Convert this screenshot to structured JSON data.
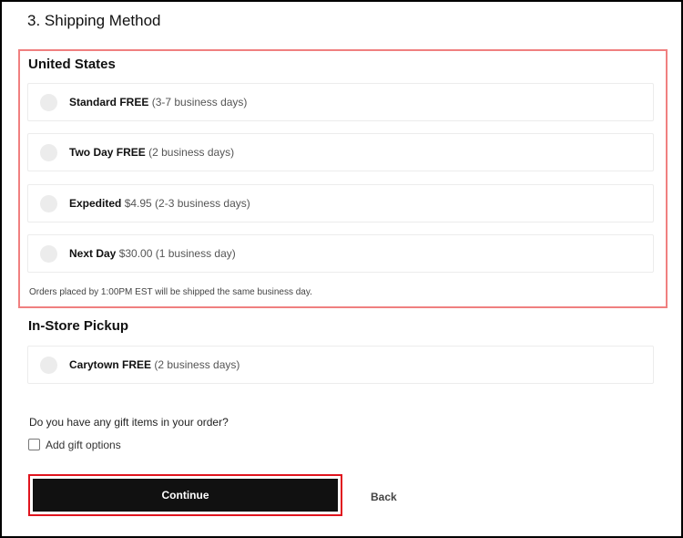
{
  "step_title": "3. Shipping Method",
  "regions": {
    "us": {
      "title": "United States",
      "options": [
        {
          "name": "Standard FREE",
          "detail": " (3-7 business days)"
        },
        {
          "name": "Two Day FREE",
          "detail": " (2 business days)"
        },
        {
          "name": "Expedited",
          "detail": " $4.95 (2-3 business days)"
        },
        {
          "name": "Next Day",
          "detail": " $30.00 (1 business day)"
        }
      ],
      "note": "Orders placed by 1:00PM EST will be shipped the same business day."
    },
    "pickup": {
      "title": "In-Store Pickup",
      "options": [
        {
          "name": "Carytown FREE",
          "detail": " (2 business days)"
        }
      ]
    }
  },
  "gift": {
    "question": "Do you have any gift items in your order?",
    "checkbox_label": "Add gift options",
    "checked": false
  },
  "actions": {
    "continue_label": "Continue",
    "back_label": "Back"
  },
  "colors": {
    "highlight_border": "#f08080",
    "continue_highlight": "#e0141e",
    "button_bg": "#111111"
  }
}
